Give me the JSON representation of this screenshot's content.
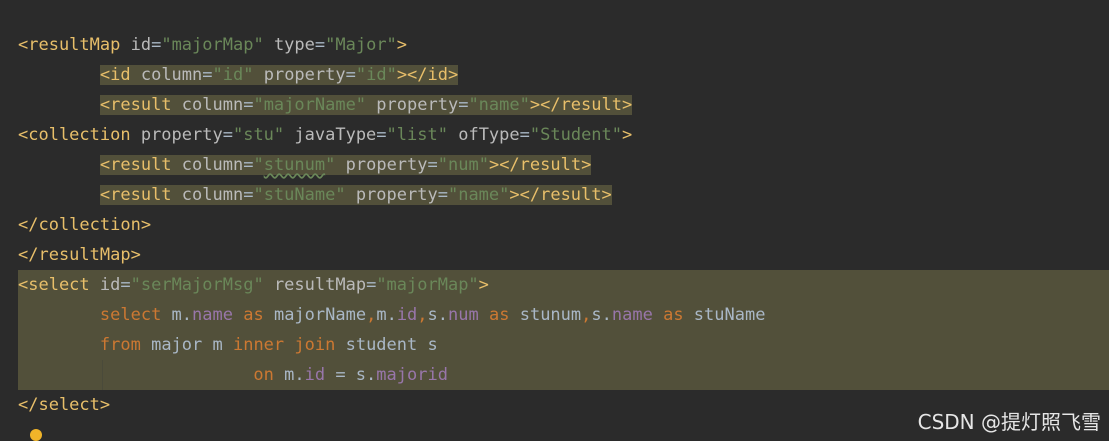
{
  "lines": [
    {
      "indent": "",
      "tokens": [
        {
          "t": "<resultMap ",
          "c": "tag"
        },
        {
          "t": "id",
          "c": "attr"
        },
        {
          "t": "=",
          "c": "txt"
        },
        {
          "t": "\"majorMap\"",
          "c": "val"
        },
        {
          "t": " ",
          "c": "txt"
        },
        {
          "t": "type",
          "c": "attr"
        },
        {
          "t": "=",
          "c": "txt"
        },
        {
          "t": "\"Major\"",
          "c": "val"
        },
        {
          "t": ">",
          "c": "tag"
        }
      ]
    },
    {
      "indent": "        ",
      "hl": true,
      "tokens": [
        {
          "t": "<id ",
          "c": "tag"
        },
        {
          "t": "column",
          "c": "attr"
        },
        {
          "t": "=",
          "c": "txt"
        },
        {
          "t": "\"id\"",
          "c": "val"
        },
        {
          "t": " ",
          "c": "txt"
        },
        {
          "t": "property",
          "c": "attr"
        },
        {
          "t": "=",
          "c": "txt"
        },
        {
          "t": "\"id\"",
          "c": "val"
        },
        {
          "t": "></id>",
          "c": "tag"
        }
      ]
    },
    {
      "indent": "        ",
      "hl": true,
      "tokens": [
        {
          "t": "<result ",
          "c": "tag"
        },
        {
          "t": "column",
          "c": "attr"
        },
        {
          "t": "=",
          "c": "txt"
        },
        {
          "t": "\"majorName\"",
          "c": "val"
        },
        {
          "t": " ",
          "c": "txt"
        },
        {
          "t": "property",
          "c": "attr"
        },
        {
          "t": "=",
          "c": "txt"
        },
        {
          "t": "\"name\"",
          "c": "val"
        },
        {
          "t": "></result>",
          "c": "tag"
        }
      ]
    },
    {
      "indent": "",
      "tokens": [
        {
          "t": "<collection ",
          "c": "tag"
        },
        {
          "t": "property",
          "c": "attr"
        },
        {
          "t": "=",
          "c": "txt"
        },
        {
          "t": "\"stu\"",
          "c": "val"
        },
        {
          "t": " ",
          "c": "txt"
        },
        {
          "t": "javaType",
          "c": "attr"
        },
        {
          "t": "=",
          "c": "txt"
        },
        {
          "t": "\"list\"",
          "c": "val"
        },
        {
          "t": " ",
          "c": "txt"
        },
        {
          "t": "ofType",
          "c": "attr"
        },
        {
          "t": "=",
          "c": "txt"
        },
        {
          "t": "\"Student\"",
          "c": "val"
        },
        {
          "t": ">",
          "c": "tag"
        }
      ]
    },
    {
      "indent": "        ",
      "hl": true,
      "tokens": [
        {
          "t": "<result ",
          "c": "tag"
        },
        {
          "t": "column",
          "c": "attr"
        },
        {
          "t": "=",
          "c": "txt"
        },
        {
          "t": "\"",
          "c": "val"
        },
        {
          "t": "stunum",
          "c": "val",
          "squiggle": true
        },
        {
          "t": "\"",
          "c": "val"
        },
        {
          "t": " ",
          "c": "txt"
        },
        {
          "t": "property",
          "c": "attr"
        },
        {
          "t": "=",
          "c": "txt"
        },
        {
          "t": "\"num\"",
          "c": "val"
        },
        {
          "t": "></result>",
          "c": "tag"
        }
      ]
    },
    {
      "indent": "        ",
      "hl": true,
      "tokens": [
        {
          "t": "<result ",
          "c": "tag"
        },
        {
          "t": "column",
          "c": "attr"
        },
        {
          "t": "=",
          "c": "txt"
        },
        {
          "t": "\"stuName\"",
          "c": "val"
        },
        {
          "t": " ",
          "c": "txt"
        },
        {
          "t": "property",
          "c": "attr"
        },
        {
          "t": "=",
          "c": "txt"
        },
        {
          "t": "\"name\"",
          "c": "val"
        },
        {
          "t": "></result>",
          "c": "tag"
        }
      ]
    },
    {
      "indent": "",
      "tokens": [
        {
          "t": "</collection>",
          "c": "tag"
        }
      ]
    },
    {
      "indent": "",
      "tokens": [
        {
          "t": "</resultMap>",
          "c": "tag"
        }
      ]
    },
    {
      "indent": "",
      "tokens": [
        {
          "t": "<select ",
          "c": "tag"
        },
        {
          "t": "id",
          "c": "attr"
        },
        {
          "t": "=",
          "c": "txt"
        },
        {
          "t": "\"serMajorMsg\"",
          "c": "val"
        },
        {
          "t": " ",
          "c": "txt"
        },
        {
          "t": "resultMap",
          "c": "attr"
        },
        {
          "t": "=",
          "c": "txt"
        },
        {
          "t": "\"majorMap\"",
          "c": "val"
        },
        {
          "t": ">",
          "c": "tag"
        }
      ]
    },
    {
      "indent": "        ",
      "tokens": [
        {
          "t": "select ",
          "c": "kw"
        },
        {
          "t": "m.",
          "c": "txt"
        },
        {
          "t": "name",
          "c": "fld"
        },
        {
          "t": " ",
          "c": "txt"
        },
        {
          "t": "as",
          "c": "kw"
        },
        {
          "t": " majorName",
          "c": "txt"
        },
        {
          "t": ",",
          "c": "kw"
        },
        {
          "t": "m.",
          "c": "txt"
        },
        {
          "t": "id",
          "c": "fld"
        },
        {
          "t": ",",
          "c": "kw"
        },
        {
          "t": "s.",
          "c": "txt"
        },
        {
          "t": "num",
          "c": "fld"
        },
        {
          "t": " ",
          "c": "txt"
        },
        {
          "t": "as",
          "c": "kw"
        },
        {
          "t": " stunum",
          "c": "txt"
        },
        {
          "t": ",",
          "c": "kw"
        },
        {
          "t": "s.",
          "c": "txt"
        },
        {
          "t": "name",
          "c": "fld"
        },
        {
          "t": " ",
          "c": "txt"
        },
        {
          "t": "as",
          "c": "kw"
        },
        {
          "t": " stuName",
          "c": "txt"
        }
      ]
    },
    {
      "indent": "        ",
      "tokens": [
        {
          "t": "from",
          "c": "kw"
        },
        {
          "t": " major m ",
          "c": "txt"
        },
        {
          "t": "inner",
          "c": "kw"
        },
        {
          "t": " ",
          "c": "txt"
        },
        {
          "t": "join",
          "c": "kw"
        },
        {
          "t": " student s",
          "c": "txt"
        }
      ]
    },
    {
      "indent": "                       ",
      "tokens": [
        {
          "t": "on",
          "c": "kw"
        },
        {
          "t": " m.",
          "c": "txt"
        },
        {
          "t": "id",
          "c": "fld"
        },
        {
          "t": " = s.",
          "c": "txt"
        },
        {
          "t": "majorid",
          "c": "fld"
        }
      ]
    },
    {
      "indent": "",
      "tokens": [
        {
          "t": "</select>",
          "c": "tag"
        }
      ]
    }
  ],
  "watermark": "CSDN @提灯照飞雪",
  "colors": {
    "background": "#2b2b2b",
    "tag": "#e8bf6a",
    "attr": "#bababa",
    "value": "#6a8759",
    "keyword": "#cc7832",
    "field": "#9876aa",
    "highlight": "#52503a"
  },
  "icons": {
    "gutter_marker": "lightbulb-icon"
  }
}
